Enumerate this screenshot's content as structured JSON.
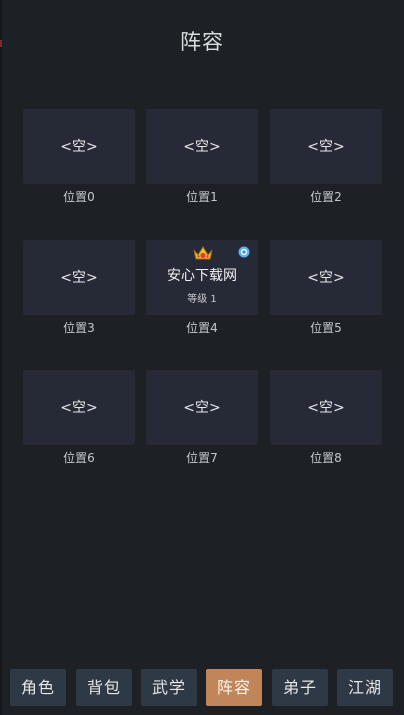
{
  "header": {
    "title": "阵容"
  },
  "slots": [
    {
      "empty_label": "<空>",
      "caption": "位置0"
    },
    {
      "empty_label": "<空>",
      "caption": "位置1"
    },
    {
      "empty_label": "<空>",
      "caption": "位置2"
    },
    {
      "empty_label": "<空>",
      "caption": "位置3"
    },
    {
      "name": "安心下载网",
      "level_text": "等级 1",
      "caption": "位置4",
      "icons": [
        "crown-icon",
        "badge-icon"
      ]
    },
    {
      "empty_label": "<空>",
      "caption": "位置5"
    },
    {
      "empty_label": "<空>",
      "caption": "位置6"
    },
    {
      "empty_label": "<空>",
      "caption": "位置7"
    },
    {
      "empty_label": "<空>",
      "caption": "位置8"
    }
  ],
  "bottom_nav": {
    "active": "阵容",
    "active_color": "#c1855a",
    "tabs": [
      {
        "label": "角色"
      },
      {
        "label": "背包"
      },
      {
        "label": "武学"
      },
      {
        "label": "阵容"
      },
      {
        "label": "弟子"
      },
      {
        "label": "江湖"
      }
    ]
  }
}
